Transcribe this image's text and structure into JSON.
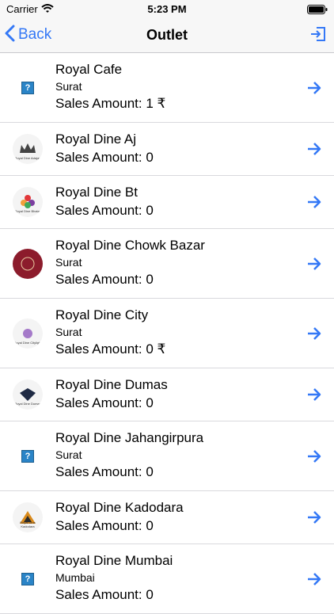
{
  "status": {
    "carrier": "Carrier",
    "time": "5:23 PM"
  },
  "nav": {
    "back_label": "Back",
    "title": "Outlet"
  },
  "outlets": [
    {
      "name": "Royal Cafe",
      "city": "Surat",
      "sales": "Sales Amount: 1 ₹",
      "logo": "placeholder-icon",
      "logo_text": ""
    },
    {
      "name": "Royal Dine Aj",
      "city": "",
      "sales": "Sales Amount: 0",
      "logo": "crown-logo",
      "logo_text": "Royal Dine Adajan"
    },
    {
      "name": "Royal Dine Bt",
      "city": "",
      "sales": "Sales Amount: 0",
      "logo": "flower-logo",
      "logo_text": "Royal Dine Bhatar"
    },
    {
      "name": "Royal Dine Chowk Bazar",
      "city": "Surat",
      "sales": "Sales Amount: 0",
      "logo": "maroon-logo",
      "logo_text": ""
    },
    {
      "name": "Royal Dine City",
      "city": "Surat",
      "sales": "Sales Amount: 0 ₹",
      "logo": "purple-logo",
      "logo_text": "Royal Dine Citylight"
    },
    {
      "name": "Royal Dine Dumas",
      "city": "",
      "sales": "Sales Amount: 0",
      "logo": "badge-logo",
      "logo_text": "Royal Dine Dumas"
    },
    {
      "name": "Royal Dine Jahangirpura",
      "city": "Surat",
      "sales": "Sales Amount: 0",
      "logo": "placeholder-icon",
      "logo_text": ""
    },
    {
      "name": "Royal Dine Kadodara",
      "city": "",
      "sales": "Sales Amount: 0",
      "logo": "triangle-logo",
      "logo_text": "Royal Dine Kadodara"
    },
    {
      "name": "Royal Dine Mumbai",
      "city": "Mumbai",
      "sales": "Sales Amount: 0",
      "logo": "placeholder-icon",
      "logo_text": ""
    }
  ],
  "colors": {
    "accent": "#3478f6",
    "bar_bg": "#f7f7f7",
    "separator": "#d9d9dd"
  }
}
